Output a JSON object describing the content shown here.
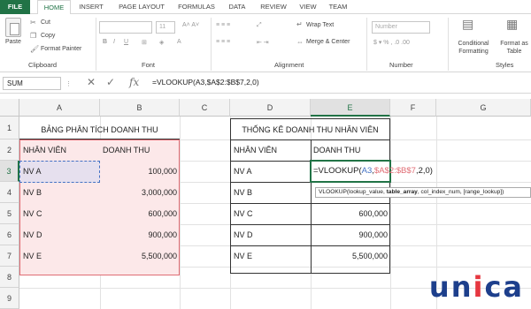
{
  "tabs": [
    "FILE",
    "HOME",
    "INSERT",
    "PAGE LAYOUT",
    "FORMULAS",
    "DATA",
    "REVIEW",
    "VIEW",
    "TEAM"
  ],
  "ribbon": {
    "paste": "Paste",
    "cut": "Cut",
    "copy": "Copy",
    "format_painter": "Format Painter",
    "clipboard": "Clipboard",
    "font_size": "11",
    "font": "Font",
    "wrap_text": "Wrap Text",
    "merge_center": "Merge & Center",
    "alignment": "Alignment",
    "number_format": "Number",
    "number": "Number",
    "conditional_formatting": "Conditional Formatting",
    "format_as_table": "Format as Table",
    "styles": "Styles"
  },
  "formula_bar": {
    "name_box": "SUM",
    "fx": "fx",
    "formula": "=VLOOKUP(A3,$A$2:$B$7,2,0)"
  },
  "columns": [
    "A",
    "B",
    "C",
    "D",
    "E",
    "F",
    "G"
  ],
  "rows": [
    "1",
    "2",
    "3",
    "4",
    "5",
    "6",
    "7",
    "8",
    "9"
  ],
  "left_table": {
    "title": "BẢNG PHÂN TÍCH DOANH THU",
    "headers": [
      "NHÂN VIÊN",
      "DOANH THU"
    ],
    "rows": [
      [
        "NV A",
        "100,000"
      ],
      [
        "NV B",
        "3,000,000"
      ],
      [
        "NV C",
        "600,000"
      ],
      [
        "NV D",
        "900,000"
      ],
      [
        "NV E",
        "5,500,000"
      ]
    ]
  },
  "right_table": {
    "title": "THỐNG KÊ DOANH THU NHÂN VIÊN",
    "headers": [
      "NHÂN VIÊN",
      "DOANH THU"
    ],
    "rows": [
      [
        "NV A",
        ""
      ],
      [
        "NV B",
        "3,000,000"
      ],
      [
        "NV C",
        "600,000"
      ],
      [
        "NV D",
        "900,000"
      ],
      [
        "NV E",
        "5,500,000"
      ]
    ]
  },
  "editing": {
    "prefix": "=VLOOKUP(",
    "ref1": "A3",
    "comma": ",",
    "ref2": "$A$2:$B$7",
    "suffix": ",2,0)"
  },
  "tooltip": {
    "fn": "VLOOKUP(",
    "arg1": "lookup_value, ",
    "arg2": "table_array",
    "rest": ", col_index_num, [range_lookup])"
  },
  "logo": {
    "u": "u",
    "n": "n",
    "i": "i",
    "c": "c",
    "a": "a"
  },
  "colors": {
    "excel_green": "#217346",
    "pink_fill": "#fce8e9",
    "range_border": "#e06c74",
    "ref_blue": "#4472c4",
    "logo_blue": "#1d3f8c",
    "logo_red": "#e63740"
  }
}
